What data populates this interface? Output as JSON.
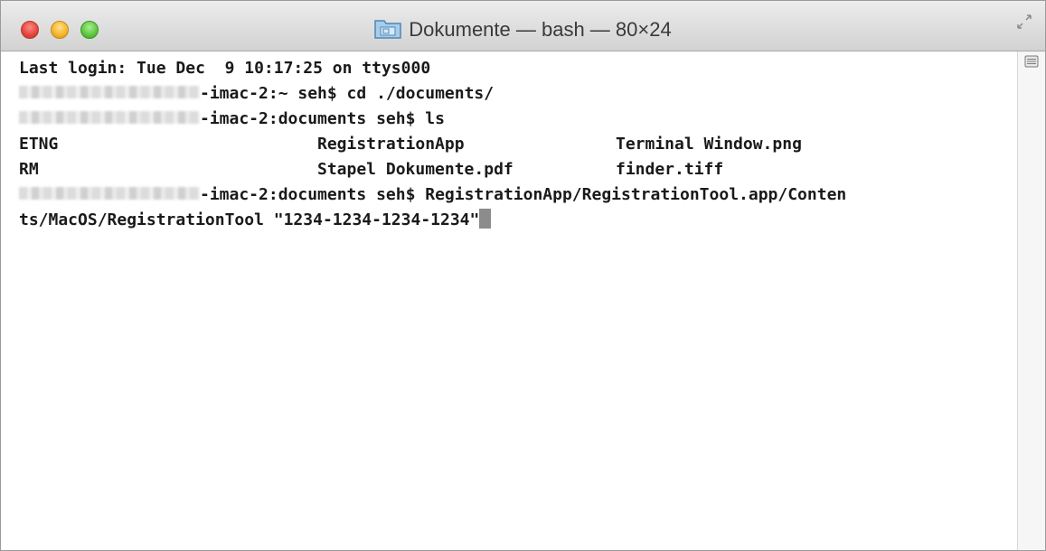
{
  "window": {
    "title": "Dokumente — bash — 80×24",
    "folder_icon": "folder-icon"
  },
  "terminal": {
    "lines": [
      {
        "text": "Last login: Tue Dec  9 10:17:25 on ttys000"
      },
      {
        "suffix": "-imac-2:~ seh$ cd ./documents/"
      },
      {
        "suffix": "-imac-2:documents seh$ ls"
      },
      {
        "cols": [
          "ETNG",
          "RegistrationApp",
          "Terminal Window.png"
        ]
      },
      {
        "cols": [
          "RM",
          "Stapel Dokumente.pdf",
          "finder.tiff"
        ]
      },
      {
        "suffix": "-imac-2:documents seh$ RegistrationApp/RegistrationTool.app/Conten"
      },
      {
        "text": "ts/MacOS/RegistrationTool \"1234-1234-1234-1234\""
      }
    ]
  },
  "colors": {
    "close": "#e0443e",
    "minimize": "#f2b42a",
    "zoom": "#5cc53f",
    "text": "#1a1a1a",
    "cursor": "#8c8c8c"
  }
}
